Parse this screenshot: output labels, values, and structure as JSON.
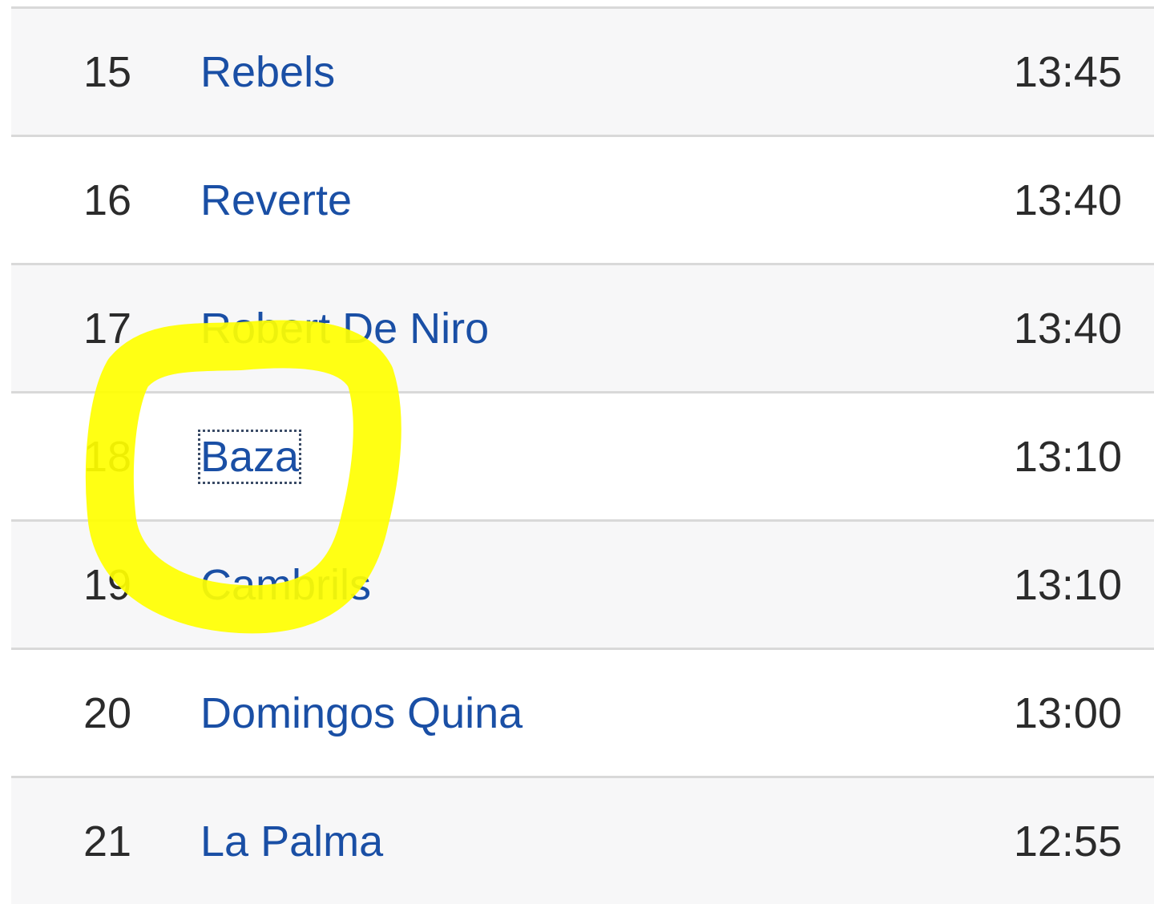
{
  "rows": [
    {
      "rank": "15",
      "name": "Rebels",
      "time": "13:45"
    },
    {
      "rank": "16",
      "name": "Reverte",
      "time": "13:40"
    },
    {
      "rank": "17",
      "name": "Robert De Niro",
      "time": "13:40"
    },
    {
      "rank": "18",
      "name": "Baza",
      "time": "13:10"
    },
    {
      "rank": "19",
      "name": "Cambrils",
      "time": "13:10"
    },
    {
      "rank": "20",
      "name": "Domingos Quina",
      "time": "13:00"
    },
    {
      "rank": "21",
      "name": "La Palma",
      "time": "12:55"
    }
  ],
  "colors": {
    "link": "#1a4fa5",
    "highlight": "#ffff00",
    "row_shade": "#f7f7f8",
    "divider": "#d9d9d9"
  }
}
